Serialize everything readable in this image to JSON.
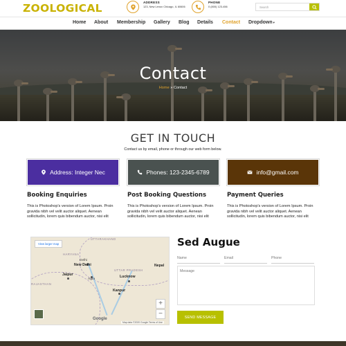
{
  "header": {
    "logo": "ZOOLOGICAL",
    "address": {
      "title": "ADDRESS",
      "text": "123, New Lenox Chicago, IL 60606"
    },
    "phone": {
      "title": "PHONE",
      "text": "0 (800) 123-456"
    },
    "search_placeholder": "Search"
  },
  "nav": {
    "items": [
      "Home",
      "About",
      "Membership",
      "Gallery",
      "Blog",
      "Details",
      "Contact",
      "Dropdown"
    ],
    "active": "Contact",
    "dropdown_caret": "▾"
  },
  "hero": {
    "title": "Contact",
    "breadcrumb_home": "Home",
    "breadcrumb_sep": "»",
    "breadcrumb_current": "Contact"
  },
  "get_in_touch": {
    "title": "GET IN TOUCH",
    "subtitle": "Contact us by email, phone or through our web form below."
  },
  "info_boxes": [
    {
      "label": "Address: Integer Nec",
      "icon": "map-marker-icon",
      "color": "#4b2ea0"
    },
    {
      "label": "Phones: 123-2345-6789",
      "icon": "phone-icon",
      "color": "#4a5250"
    },
    {
      "label": "info@gmail.com",
      "icon": "envelope-icon",
      "color": "#5a3508"
    }
  ],
  "columns": [
    {
      "title": "Booking Enquiries",
      "text": "This is Photoshop's version of Lorem Ipsum. Proin gravida nibh vel velit auctor aliquet. Aenean sollicitudin, lorem quis bibendum auctor, nisi elit"
    },
    {
      "title": "Post Booking Questions",
      "text": "This is Photoshop's version of Lorem Ipsum. Proin gravida nibh vel velit auctor aliquet. Aenean sollicitudin, lorem quis bibendum auctor, nisi elit"
    },
    {
      "title": "Payment Queries",
      "text": "This is Photoshop's version of Lorem Ipsum. Proin gravida nibh vel velit auctor aliquet. Aenean sollicitudin, lorem quis bibendum auctor, nisi elit"
    }
  ],
  "map": {
    "view_larger": "View larger map",
    "labels": {
      "uttarakhand": "UTTARAKHAND",
      "haryana": "HARYANA",
      "new_delhi": "New Delhi",
      "delhi": "Delhi",
      "nepal": "Nepal",
      "uttar_pradesh": "UTTAR PRADESH",
      "jaipur": "Jaipur",
      "agra": "Agra",
      "lucknow": "Lucknow",
      "rajasthan": "RAJASTHAN",
      "kanpur": "Kanpur"
    },
    "zoom_in": "+",
    "zoom_out": "−",
    "google": "Google",
    "footer": "Map data ©2020 Google   Terms of Use"
  },
  "form": {
    "title": "Sed Augue",
    "name_placeholder": "Name",
    "email_placeholder": "Email",
    "phone_placeholder": "Phone",
    "message_placeholder": "Message",
    "submit_label": "SEND MESSAGE"
  },
  "colors": {
    "accent_gold": "#e0a22b",
    "logo": "#c9b200",
    "button_lime": "#b8c000"
  }
}
